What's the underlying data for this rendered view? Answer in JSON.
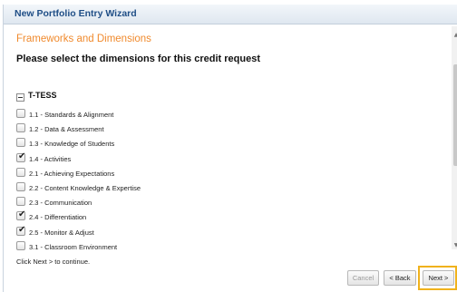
{
  "window": {
    "title": "New Portfolio Entry Wizard"
  },
  "section": {
    "title": "Frameworks and Dimensions"
  },
  "instruction": "Please select the dimensions for this credit request",
  "tree": {
    "label": "T-TESS",
    "items": [
      {
        "label": "1.1 - Standards & Alignment",
        "checked": false
      },
      {
        "label": "1.2 - Data & Assessment",
        "checked": false
      },
      {
        "label": "1.3 - Knowledge of Students",
        "checked": false
      },
      {
        "label": "1.4 - Activities",
        "checked": true
      },
      {
        "label": "2.1 - Achieving Expectations",
        "checked": false
      },
      {
        "label": "2.2 - Content Knowledge & Expertise",
        "checked": false
      },
      {
        "label": "2.3 - Communication",
        "checked": false
      },
      {
        "label": "2.4 - Differentiation",
        "checked": true
      },
      {
        "label": "2.5 - Monitor & Adjust",
        "checked": true
      },
      {
        "label": "3.1 - Classroom Environment",
        "checked": false
      }
    ]
  },
  "footer": {
    "hint": "Click Next > to continue."
  },
  "buttons": {
    "cancel": "Cancel",
    "back": "< Back",
    "next": "Next >"
  },
  "colors": {
    "section_title": "#f08a2d",
    "window_title": "#1f4e86",
    "next_highlight": "#f0b21c"
  }
}
